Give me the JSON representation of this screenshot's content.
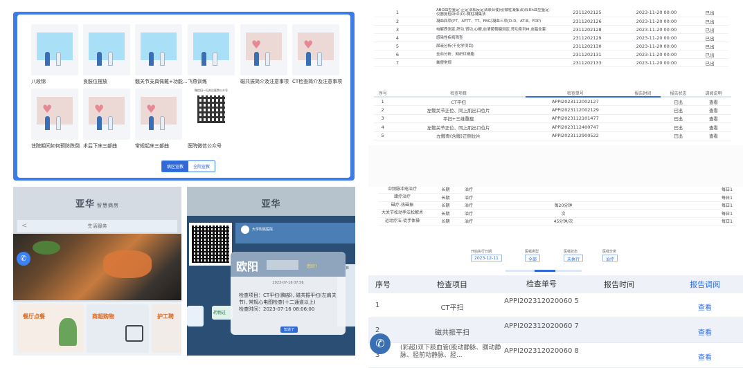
{
  "education_panel": {
    "tiles": [
      {
        "caption": "八段锦",
        "style": "blue"
      },
      {
        "caption": "良肢位摆放",
        "style": "blue"
      },
      {
        "caption": "髋关节支具佩戴+功能...",
        "style": "blue"
      },
      {
        "caption": "飞燕训练",
        "style": "blue"
      },
      {
        "caption": "磁共振简介及注意事项",
        "style": "pink"
      },
      {
        "caption": "CT检查简介及注意事项",
        "style": "pink"
      },
      {
        "caption": "住院期间如何预防跌倒",
        "style": "pink"
      },
      {
        "caption": "术后下床三部曲",
        "style": "pink"
      },
      {
        "caption": "常规起床三部曲",
        "style": "pink"
      },
      {
        "caption": "医院微信公众号",
        "style": "qr"
      }
    ],
    "qr_title": "微信扫一扫关注医院公众号",
    "toggle": {
      "left": "病区宣教",
      "right": "全院宣教",
      "active": "left"
    }
  },
  "kiosk_life": {
    "brand": "亚华",
    "brand_sub": "智慧病房",
    "header": "生活服务",
    "back": "<",
    "cards": [
      {
        "label": "餐厅点餐"
      },
      {
        "label": "商超购物"
      },
      {
        "label": "护工聘"
      }
    ],
    "phone_icon": "✆"
  },
  "kiosk_popup": {
    "brand": "亚华",
    "hospital": "大学附属医院",
    "name": "欧阳",
    "greeting": "您好！",
    "timestamp": "2023-07-16 07:56",
    "exam_items": "检查项目：CT平扫(胸部), 磁共振平扫(左肩关节), 常规心电图检查(十二通道以上)",
    "exam_time": "检查时间：2023-07-16 08:06:00",
    "ok_button": "知道了",
    "tab_label": "药物过",
    "right_label": "入院日"
  },
  "lab_table": {
    "rows": [
      {
        "n": "1",
        "name": "ABO血型鉴定-正定法和反定法联合使用(微柱凝集法)和Rh血型鉴定-仪器复检RhD(D)-微柱凝集法",
        "id": "2311202125",
        "time": "2023-11-20 00:00",
        "action": "已出"
      },
      {
        "n": "2",
        "name": "凝血四项(PT、APTT、TT、FBG)凝血三项(D-D、AT-Ⅲ、FDP)",
        "id": "2311202126",
        "time": "2023-11-20 00:00",
        "action": "已出"
      },
      {
        "n": "3",
        "name": "电解质测定,肝功,肾功,心梗,血清葡萄糖测定,肾功系列M,血脂全套",
        "id": "2311202128",
        "time": "2023-11-20 00:00",
        "action": "已出"
      },
      {
        "n": "4",
        "name": "感染性疾病筛查",
        "id": "2311202129",
        "time": "2023-11-20 00:00",
        "action": "已出"
      },
      {
        "n": "5",
        "name": "尿液分析(干化学项目)",
        "id": "2311202130",
        "time": "2023-11-20 00:00",
        "action": "已出"
      },
      {
        "n": "6",
        "name": "全血分析、网织红细胞",
        "id": "2311202131",
        "time": "2023-11-20 00:00",
        "action": "已出"
      },
      {
        "n": "7",
        "name": "粪便常规",
        "id": "2311202133",
        "time": "2023-11-20 00:00",
        "action": "已出"
      }
    ]
  },
  "imaging_table": {
    "headers": [
      "序号",
      "检查项目",
      "检查单号",
      "报告时间",
      "报告状态",
      "调阅说明"
    ],
    "rows": [
      {
        "n": "1",
        "item": "CT平扫",
        "id": "APPI2023112002127",
        "status": "已出",
        "action": "查看"
      },
      {
        "n": "2",
        "item": "左髋关节正位、同上肌出口位片",
        "id": "APPI2023112002129",
        "status": "已出",
        "action": "查看"
      },
      {
        "n": "3",
        "item": "平扫+三维重建",
        "id": "APPI2023112101477",
        "status": "已出",
        "action": "查看"
      },
      {
        "n": "4",
        "item": "左髋关节正位、同上肌出口位片",
        "id": "APPI2023112400747",
        "status": "已出",
        "action": "查看"
      },
      {
        "n": "5",
        "item": "左髋骨(含髋)正侧位片",
        "id": "APPI2023112900522",
        "status": "已出",
        "action": "查看"
      }
    ]
  },
  "orders_table": {
    "rows": [
      {
        "name": "中频脉冲电治疗",
        "type": "长期",
        "cat": "治疗",
        "freq": "",
        "right": "每日1"
      },
      {
        "name": "蜡疗治疗",
        "type": "长期",
        "cat": "治疗",
        "freq": "",
        "right": "每日1"
      },
      {
        "name": "磁疗-热磁振",
        "type": "长期",
        "cat": "治疗",
        "freq": "每20分钟",
        "right": "每日1"
      },
      {
        "name": "大关节松动手法松解术",
        "type": "长期",
        "cat": "治疗",
        "freq": "次",
        "right": "每日1"
      },
      {
        "name": "运动疗法-徒手体操",
        "type": "长期",
        "cat": "治疗",
        "freq": "45分钟/次",
        "right": "每日1"
      }
    ],
    "filters": [
      {
        "label": "开始执行日期",
        "value": "2023-12-11"
      },
      {
        "label": "医嘱类型",
        "value": "全部"
      },
      {
        "label": "医嘱状态",
        "value": "未执行"
      },
      {
        "label": "医嘱分类",
        "value": "治疗"
      }
    ]
  },
  "report_list": {
    "headers": [
      "序号",
      "检查项目",
      "检查单号",
      "报告时间",
      "报告调阅"
    ],
    "rows": [
      {
        "n": "1",
        "item": "CT平扫",
        "id": "APPI202312020060 5",
        "time": "",
        "action": "查看"
      },
      {
        "n": "2",
        "item": "磁共振平扫",
        "id": "APPI202312020060 7",
        "time": "",
        "action": "查看"
      },
      {
        "n": "3",
        "item": "(彩超)双下肢血管(股动静脉、腘动静脉、胫前动静脉、胫...",
        "id": "APPI202312020060 8",
        "time": "",
        "action": "查看"
      }
    ]
  },
  "colors": {
    "accent": "#2f6ad8",
    "frame": "#3d7be6",
    "link": "#2f6ad8"
  }
}
